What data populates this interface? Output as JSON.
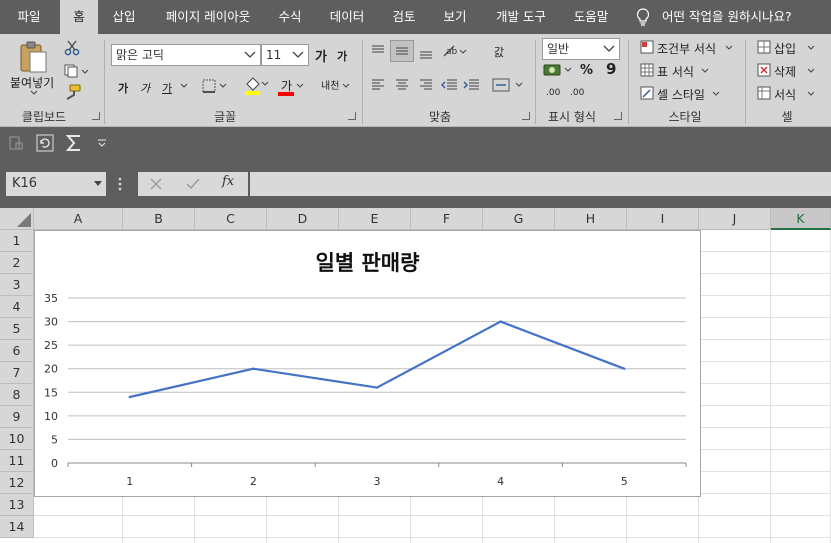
{
  "menu": {
    "tabs": [
      "파일",
      "홈",
      "삽입",
      "페이지 레이아웃",
      "수식",
      "데이터",
      "검토",
      "보기",
      "개발 도구",
      "도움말"
    ],
    "active_tab": "홈",
    "tell_me": "어떤 작업을 원하시나요?"
  },
  "ribbon": {
    "clipboard": {
      "paste": "붙여넣기",
      "label": "클립보드"
    },
    "font": {
      "name": "맑은 고딕",
      "size": "11",
      "label": "글꼴",
      "bold": "가",
      "italic": "가",
      "underline": "가",
      "grow": "가",
      "shrink": "가",
      "font_color": "가",
      "phonetic": "내천"
    },
    "alignment": {
      "label": "맞춤",
      "wrap": "갌"
    },
    "number": {
      "format": "일반",
      "percent": "%",
      "comma": "9",
      "dec_inc": ".00",
      "dec_dec": ".00",
      "label": "표시 형식"
    },
    "styles": {
      "conditional": "조건부 서식",
      "table": "표 서식",
      "cell": "셀 스타일",
      "label": "스타일"
    },
    "cells": {
      "insert": "삽입",
      "delete": "삭제",
      "format": "서식",
      "label": "셀"
    }
  },
  "formula_bar": {
    "name_box": "K16",
    "fx": "fx",
    "formula": ""
  },
  "sheet": {
    "columns": [
      "A",
      "B",
      "C",
      "D",
      "E",
      "F",
      "G",
      "H",
      "I",
      "J",
      "K"
    ],
    "rows": [
      "1",
      "2",
      "3",
      "4",
      "5",
      "6",
      "7",
      "8",
      "9",
      "10",
      "11",
      "12",
      "13",
      "14"
    ],
    "selected_column": "K"
  },
  "colors": {
    "series": "#4472c4",
    "accent": "#217346"
  },
  "chart_data": {
    "type": "line",
    "title": "일별 판매량",
    "categories": [
      "1",
      "2",
      "3",
      "4",
      "5"
    ],
    "values": [
      14,
      20,
      16,
      30,
      20
    ],
    "yticks": [
      "0",
      "5",
      "10",
      "15",
      "20",
      "25",
      "30",
      "35"
    ],
    "ylim": [
      0,
      35
    ],
    "grid": true,
    "legend": "none"
  }
}
